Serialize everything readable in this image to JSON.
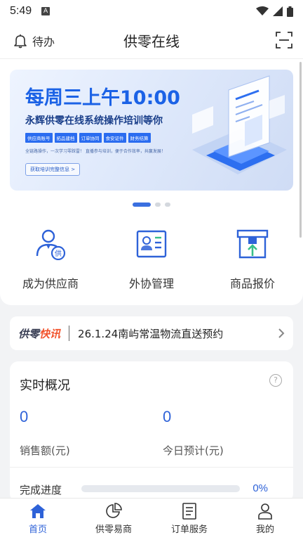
{
  "status_bar": {
    "time": "5:49",
    "notification_icon": "A"
  },
  "header": {
    "todo_label": "待办",
    "title": "供零在线",
    "scan_icon": "scan-icon"
  },
  "banner": {
    "headline": "每周三上午10:00",
    "subtitle": "永辉供零在线系统操作培训等你",
    "tags": [
      "供应商账号",
      "拓品建档",
      "订单协同",
      "食安证件",
      "财务结算"
    ],
    "description": "全链路操作，一次学习零踩雷！ 直播参与培训，便于合作效率，共赢发展！",
    "button": "获取培训完整信息 >"
  },
  "carousel": {
    "count": 3,
    "active_index": 0
  },
  "shortcuts": [
    {
      "label": "成为供应商",
      "icon": "supplier-icon"
    },
    {
      "label": "外协管理",
      "icon": "id-card-icon"
    },
    {
      "label": "商品报价",
      "icon": "box-upload-icon"
    }
  ],
  "notice": {
    "brand_part1": "供零",
    "brand_part2": "快讯",
    "text": "26.1.24南屿常温物流直送预约"
  },
  "overview": {
    "title": "实时概况",
    "sales_value": "0",
    "sales_label": "销售额(元)",
    "forecast_value": "0",
    "forecast_label": "今日预计(元)",
    "progress_label": "完成进度",
    "progress_value": "0%",
    "progress_fraction": 0
  },
  "tabs": [
    {
      "label": "首页",
      "icon": "home-icon",
      "active": true
    },
    {
      "label": "供零易商",
      "icon": "pie-chart-icon",
      "active": false
    },
    {
      "label": "订单服务",
      "icon": "document-icon",
      "active": false
    },
    {
      "label": "我的",
      "icon": "user-icon",
      "active": false
    }
  ],
  "colors": {
    "accent": "#2e62d8",
    "brand_orange": "#f2542d",
    "background": "#f2f3f5"
  }
}
